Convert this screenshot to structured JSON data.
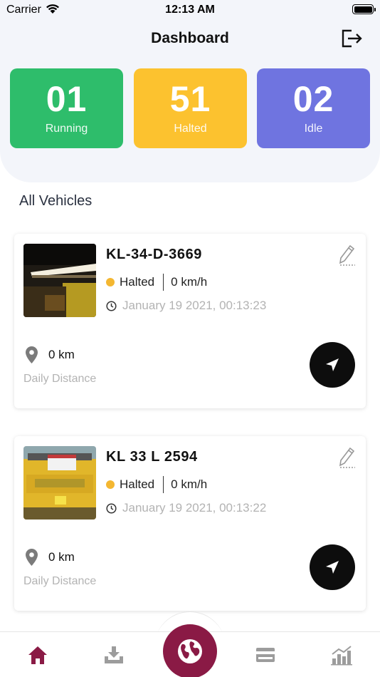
{
  "status_bar": {
    "carrier": "Carrier",
    "time": "12:13 AM"
  },
  "header": {
    "title": "Dashboard"
  },
  "stats": [
    {
      "value": "01",
      "label": "Running",
      "color": "#2ebd6b"
    },
    {
      "value": "51",
      "label": "Halted",
      "color": "#fcc22f"
    },
    {
      "value": "02",
      "label": "Idle",
      "color": "#6f74e0"
    }
  ],
  "section_title": "All Vehicles",
  "vehicles": [
    {
      "plate": "KL-34-D-3669",
      "status": "Halted",
      "speed": "0 km/h",
      "timestamp": "January 19 2021, 00:13:23",
      "distance": "0 km",
      "distance_label": "Daily Distance"
    },
    {
      "plate": "KL 33 L 2594",
      "status": "Halted",
      "speed": "0 km/h",
      "timestamp": "January 19 2021, 00:13:22",
      "distance": "0 km",
      "distance_label": "Daily Distance"
    }
  ],
  "tabs": [
    "home-icon",
    "download-icon",
    "globe-icon",
    "card-icon",
    "chart-icon"
  ],
  "colors": {
    "accent": "#8a1a45",
    "halted": "#f4b731"
  }
}
